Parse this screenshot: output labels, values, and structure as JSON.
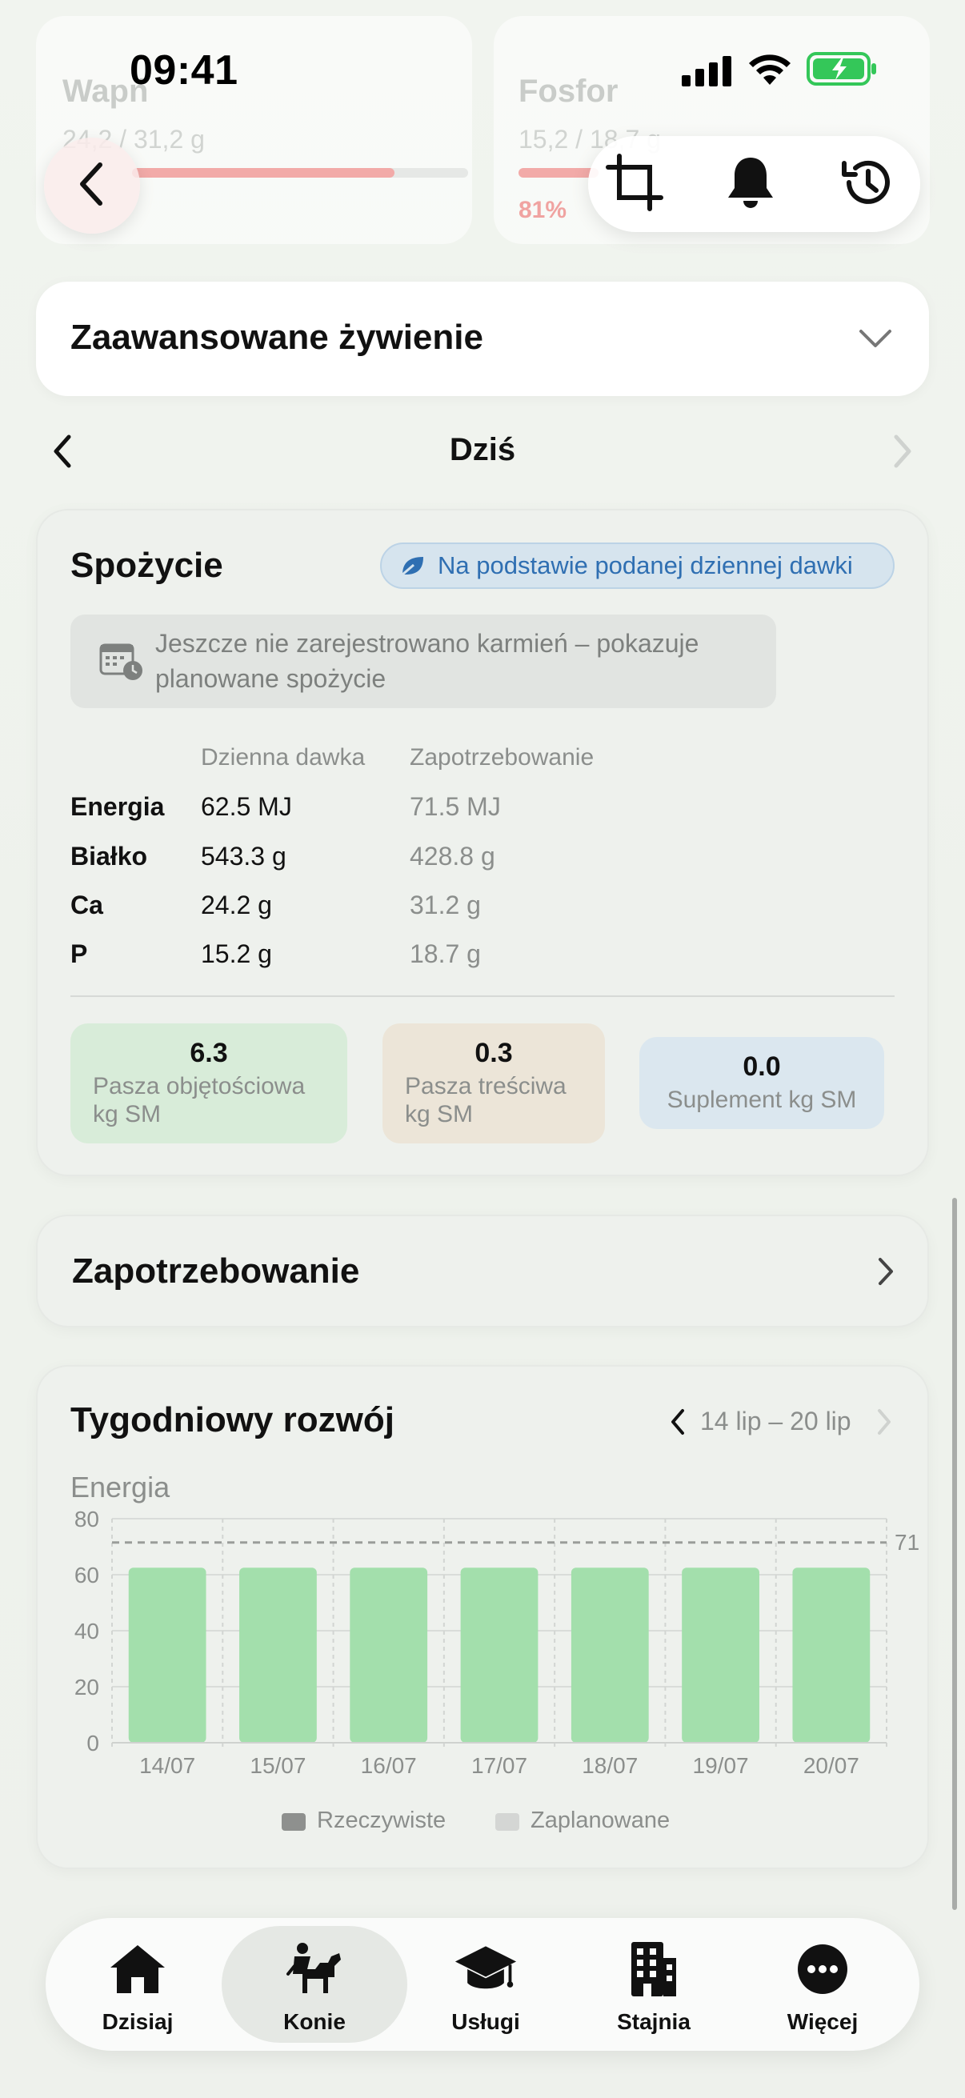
{
  "status_bar": {
    "time": "09:41"
  },
  "header_faded": {
    "left": {
      "title": "Wapń",
      "value": "24,2 / 31,2 g",
      "progress": 0.78
    },
    "right": {
      "title": "Fosfor",
      "value": "15,2 / 18,7 g",
      "percent_label": "81%",
      "progress": 0.81
    }
  },
  "toolbar": {
    "icons": [
      "crop-icon",
      "bell-icon",
      "history-icon"
    ]
  },
  "advanced_nutrition": {
    "title": "Zaawansowane żywienie"
  },
  "day_nav": {
    "label": "Dziś"
  },
  "intake": {
    "title": "Spożycie",
    "badge": "Na podstawie podanej dziennej dawki",
    "info": "Jeszcze nie zarejestrowano karmień – pokazuje planowane spożycie",
    "headers": {
      "daily": "Dzienna dawka",
      "requirement": "Zapotrzebowanie"
    },
    "rows": [
      {
        "label": "Energia",
        "daily": "62.5 MJ",
        "req": "71.5 MJ"
      },
      {
        "label": "Białko",
        "daily": "543.3 g",
        "req": "428.8 g"
      },
      {
        "label": "Ca",
        "daily": "24.2 g",
        "req": "31.2 g"
      },
      {
        "label": "P",
        "daily": "15.2 g",
        "req": "18.7 g"
      }
    ],
    "tiles": [
      {
        "value": "6.3",
        "label": "Pasza objętościowa kg SM",
        "color": "#d8ecd9"
      },
      {
        "value": "0.3",
        "label": "Pasza treściwa kg SM",
        "color": "#ece5d8"
      },
      {
        "value": "0.0",
        "label": "Suplement kg SM",
        "color": "#dbe7ef"
      }
    ]
  },
  "requirements": {
    "title": "Zapotrzebowanie"
  },
  "weekly": {
    "title": "Tygodniowy rozwój",
    "range": "14 lip – 20 lip",
    "legend": [
      "Rzeczywiste",
      "Zaplanowane"
    ]
  },
  "chart_data": {
    "type": "bar",
    "title": "Energia",
    "categories": [
      "14/07",
      "15/07",
      "16/07",
      "17/07",
      "18/07",
      "19/07",
      "20/07"
    ],
    "values": [
      62.5,
      62.5,
      62.5,
      62.5,
      62.5,
      62.5,
      62.5
    ],
    "ylim": [
      0,
      80
    ],
    "yticks": [
      0,
      20,
      40,
      60,
      80
    ],
    "reference_line": {
      "value": 71.5,
      "label": "71"
    },
    "bar_color": "#a3dfac",
    "grid": true,
    "legend_position": "bottom"
  },
  "tabbar": {
    "tabs": [
      {
        "label": "Dzisiaj",
        "icon": "home-icon"
      },
      {
        "label": "Konie",
        "icon": "horse-rider-icon"
      },
      {
        "label": "Usługi",
        "icon": "graduation-cap-icon"
      },
      {
        "label": "Stajnia",
        "icon": "building-icon"
      },
      {
        "label": "Więcej",
        "icon": "more-icon"
      }
    ],
    "active": "Konie"
  }
}
